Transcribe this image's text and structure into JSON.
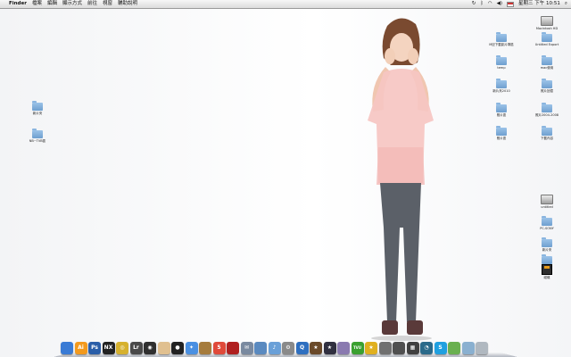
{
  "menubar": {
    "apple": "",
    "app_name": "Finder",
    "menus": [
      "檔案",
      "編輯",
      "顯示方式",
      "前往",
      "視窗",
      "輔助說明"
    ],
    "clock": "星期三 下午 10:51"
  },
  "desktop": {
    "left_icons": [
      {
        "label": "新片夾",
        "kind": "folder"
      },
      {
        "label": "NB~TVB區",
        "kind": "folder"
      }
    ],
    "right_icons": [
      {
        "label": "Macintosh HD",
        "kind": "disk"
      },
      {
        "label": "M記下載影片專區",
        "kind": "folder"
      },
      {
        "label": "Untitled Export",
        "kind": "folder"
      },
      {
        "label": "temp",
        "kind": "folder"
      },
      {
        "label": "mac使用",
        "kind": "folder"
      },
      {
        "label": "新片夾2010",
        "kind": "folder"
      },
      {
        "label": "照片回憶",
        "kind": "folder"
      },
      {
        "label": "照片區",
        "kind": "folder"
      },
      {
        "label": "照片2004-2008",
        "kind": "folder"
      },
      {
        "label": "照片區",
        "kind": "folder"
      },
      {
        "label": "下載內容",
        "kind": "folder"
      },
      {
        "label": "untitled",
        "kind": "disk"
      },
      {
        "label": "PC-SONY",
        "kind": "folder"
      },
      {
        "label": "新片夾",
        "kind": "folder"
      },
      {
        "label": "PHOTO",
        "kind": "folder"
      },
      {
        "label": "磁碟",
        "kind": "floppy"
      }
    ]
  },
  "dock": {
    "items": [
      {
        "name": "finder-icon",
        "glyph": "",
        "color": "#3a7bd5"
      },
      {
        "name": "illustrator-icon",
        "glyph": "Ai",
        "color": "#f39a1e"
      },
      {
        "name": "photoshop-icon",
        "glyph": "Ps",
        "color": "#2a5ea8"
      },
      {
        "name": "nx-icon",
        "glyph": "NX",
        "color": "#222222"
      },
      {
        "name": "camera-icon",
        "glyph": "◎",
        "color": "#d6b12f"
      },
      {
        "name": "lightroom-icon",
        "glyph": "Lr",
        "color": "#4a4a4a"
      },
      {
        "name": "aperture-icon",
        "glyph": "◉",
        "color": "#303030"
      },
      {
        "name": "itunes-folder-icon",
        "glyph": "",
        "color": "#e0c090"
      },
      {
        "name": "dvd-player-icon",
        "glyph": "●",
        "color": "#222222"
      },
      {
        "name": "safari-icon",
        "glyph": "✦",
        "color": "#4a90e2"
      },
      {
        "name": "address-book-icon",
        "glyph": "",
        "color": "#a67c3d"
      },
      {
        "name": "calendar-icon",
        "glyph": "5",
        "color": "#e04a3a"
      },
      {
        "name": "photo-booth-icon",
        "glyph": "",
        "color": "#b02020"
      },
      {
        "name": "mail-icon",
        "glyph": "✉",
        "color": "#7a8aa0"
      },
      {
        "name": "iphoto-icon",
        "glyph": "",
        "color": "#5a8ac0"
      },
      {
        "name": "itunes-icon",
        "glyph": "♪",
        "color": "#6aa0d8"
      },
      {
        "name": "system-preferences-icon",
        "glyph": "⚙",
        "color": "#8a8a8a"
      },
      {
        "name": "quicktime-icon",
        "glyph": "Q",
        "color": "#2e6fc0"
      },
      {
        "name": "imovie-icon",
        "glyph": "★",
        "color": "#6a4a2a"
      },
      {
        "name": "idvd-icon",
        "glyph": "★",
        "color": "#303040"
      },
      {
        "name": "garageband-icon",
        "glyph": "",
        "color": "#8a7ab0"
      },
      {
        "name": "tvu-icon",
        "glyph": "TVU",
        "color": "#3aa030"
      },
      {
        "name": "star-icon",
        "glyph": "★",
        "color": "#e0b020"
      },
      {
        "name": "grapher-icon",
        "glyph": "",
        "color": "#707070"
      },
      {
        "name": "calculator-icon",
        "glyph": "",
        "color": "#505050"
      },
      {
        "name": "grid-icon",
        "glyph": "▦",
        "color": "#404040"
      },
      {
        "name": "time-machine-icon",
        "glyph": "◔",
        "color": "#2a6a8a"
      },
      {
        "name": "skype-icon",
        "glyph": "S",
        "color": "#20a0e0"
      },
      {
        "name": "applications-stack-icon",
        "glyph": "",
        "color": "#6ab050"
      },
      {
        "name": "documents-stack-icon",
        "glyph": "",
        "color": "#8ab0d0"
      },
      {
        "name": "trash-icon",
        "glyph": "",
        "color": "#b0b8c0"
      }
    ]
  }
}
